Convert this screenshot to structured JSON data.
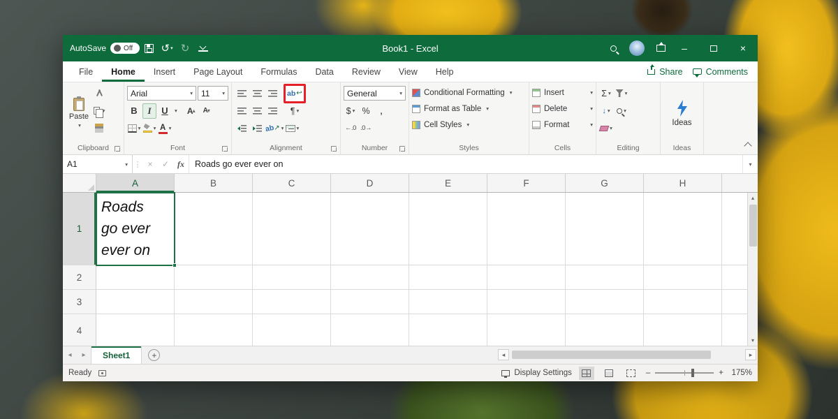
{
  "window": {
    "autosave_label": "AutoSave",
    "autosave_state": "Off",
    "title": "Book1 - Excel"
  },
  "menu": {
    "tabs": [
      {
        "label": "File"
      },
      {
        "label": "Home"
      },
      {
        "label": "Insert"
      },
      {
        "label": "Page Layout"
      },
      {
        "label": "Formulas"
      },
      {
        "label": "Data"
      },
      {
        "label": "Review"
      },
      {
        "label": "View"
      },
      {
        "label": "Help"
      }
    ],
    "share": "Share",
    "comments": "Comments"
  },
  "ribbon": {
    "clipboard": {
      "label": "Clipboard",
      "paste": "Paste"
    },
    "font": {
      "label": "Font",
      "name": "Arial",
      "size": "11",
      "bold": "B",
      "italic": "I",
      "underline": "U",
      "grow": "A",
      "shrink": "A",
      "color_letter": "A"
    },
    "alignment": {
      "label": "Alignment",
      "wrap_ab": "ab",
      "orientation_ab": "ab"
    },
    "number": {
      "label": "Number",
      "format": "General",
      "dollar": "$",
      "percent": "%",
      "comma": ",",
      "add_decimal": "←.0",
      "remove_decimal": ".0→"
    },
    "styles": {
      "label": "Styles",
      "items": [
        {
          "label": "Conditional Formatting"
        },
        {
          "label": "Format as Table"
        },
        {
          "label": "Cell Styles"
        }
      ]
    },
    "cells": {
      "label": "Cells",
      "items": [
        {
          "label": "Insert"
        },
        {
          "label": "Delete"
        },
        {
          "label": "Format"
        }
      ]
    },
    "editing": {
      "label": "Editing",
      "sigma": "Σ"
    },
    "ideas": {
      "label": "Ideas",
      "button_label": "Ideas"
    }
  },
  "formula_bar": {
    "name_box": "A1",
    "fx": "fx",
    "value": "Roads go ever ever on"
  },
  "grid": {
    "columns": [
      "A",
      "B",
      "C",
      "D",
      "E",
      "F",
      "G",
      "H"
    ],
    "rows": [
      "1",
      "2",
      "3",
      "4"
    ],
    "a1_lines": [
      "Roads",
      "go ever",
      "ever on"
    ]
  },
  "sheet_bar": {
    "tab": "Sheet1"
  },
  "status_bar": {
    "ready": "Ready",
    "display_settings": "Display Settings",
    "zoom": "175%"
  },
  "glyphs": {
    "undo": "↺",
    "redo": "↻",
    "dd": "▾",
    "check": "✓",
    "cancel": "×",
    "minimize": "–",
    "close": "×",
    "vdots": "⋮",
    "left": "◂",
    "right": "▸",
    "up": "▴",
    "down": "▾",
    "plus": "+",
    "minus": "–",
    "arrow_ne": "↗",
    "wrap_return": "↩",
    "pilcrow": "¶"
  },
  "colors": {
    "title_green": "#0e6b3c",
    "accent_green": "#1e7145",
    "callout_red": "#e52028"
  }
}
